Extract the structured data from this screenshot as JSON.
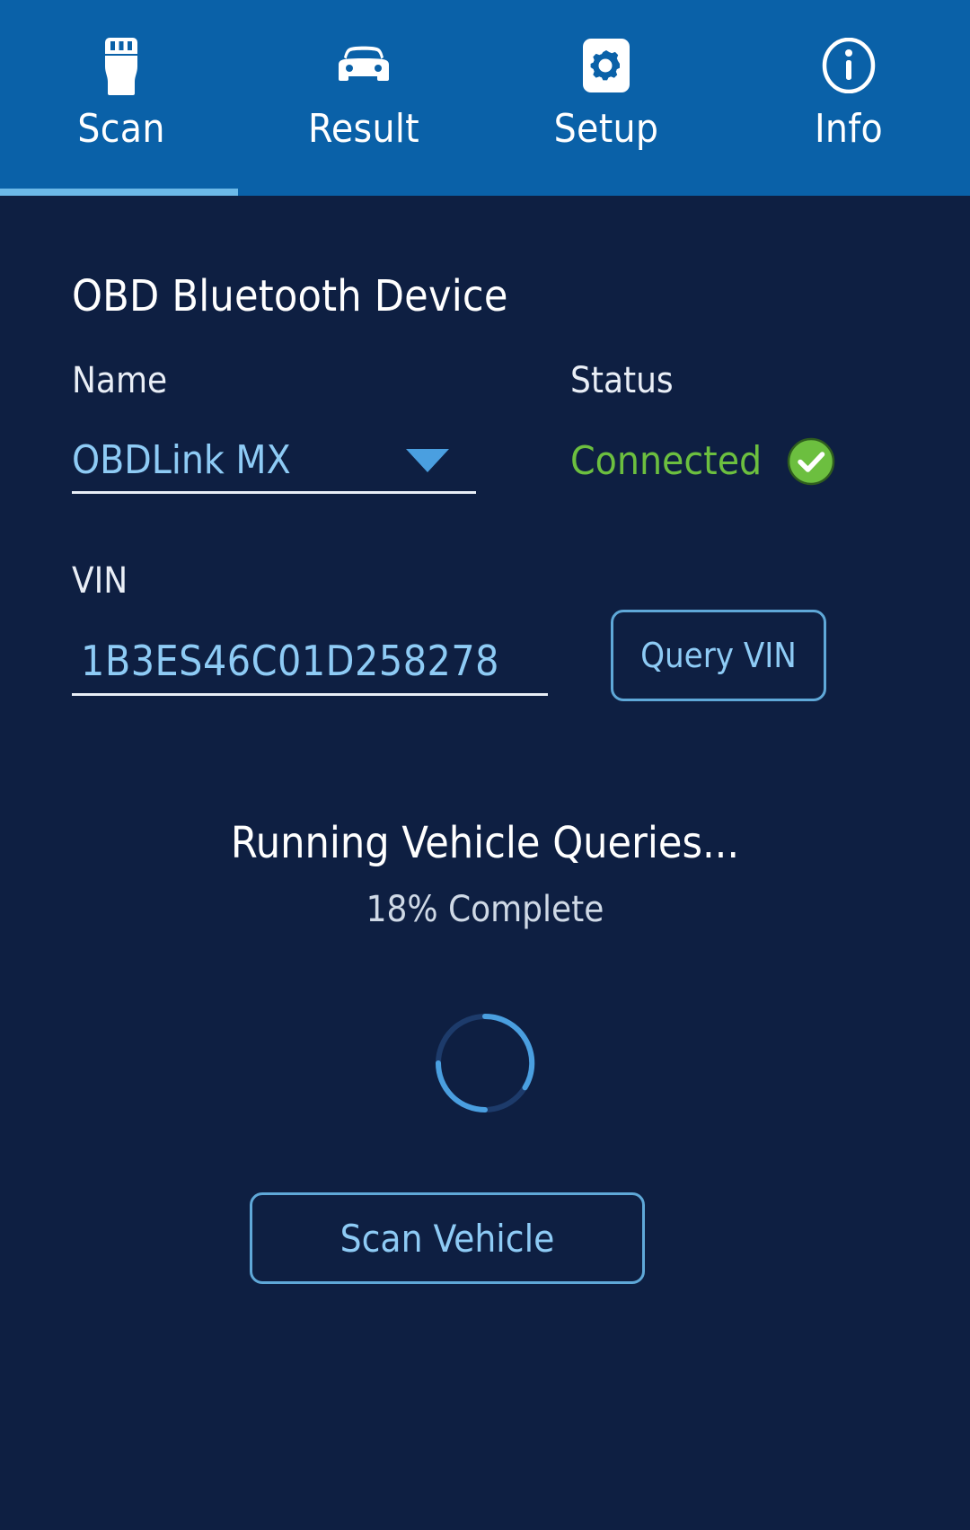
{
  "tabs": [
    {
      "label": "Scan",
      "icon": "obd-plug-icon",
      "active": true
    },
    {
      "label": "Result",
      "icon": "car-icon",
      "active": false
    },
    {
      "label": "Setup",
      "icon": "gear-icon",
      "active": false
    },
    {
      "label": "Info",
      "icon": "info-circle-icon",
      "active": false
    }
  ],
  "device": {
    "section_title": "OBD Bluetooth Device",
    "name_label": "Name",
    "name_value": "OBDLink MX",
    "name_dropdown_icon": "chevron-down-icon",
    "status_label": "Status",
    "status_value": "Connected",
    "status_icon": "check-circle-icon"
  },
  "vin": {
    "label": "VIN",
    "value": "1B3ES46C01D258278",
    "query_button_label": "Query VIN"
  },
  "progress": {
    "title": "Running Vehicle Queries...",
    "subtitle": "18% Complete",
    "percent": 18,
    "spinner_icon": "loading-spinner-icon"
  },
  "actions": {
    "scan_vehicle_label": "Scan Vehicle"
  },
  "colors": {
    "tabbar_blue": "#0a61a8",
    "body_navy": "#0e1f42",
    "accent_light_blue": "#8ecbf5",
    "active_underline": "#6cb9e8",
    "status_green": "#6cbf3f",
    "text_white": "#ffffff"
  }
}
